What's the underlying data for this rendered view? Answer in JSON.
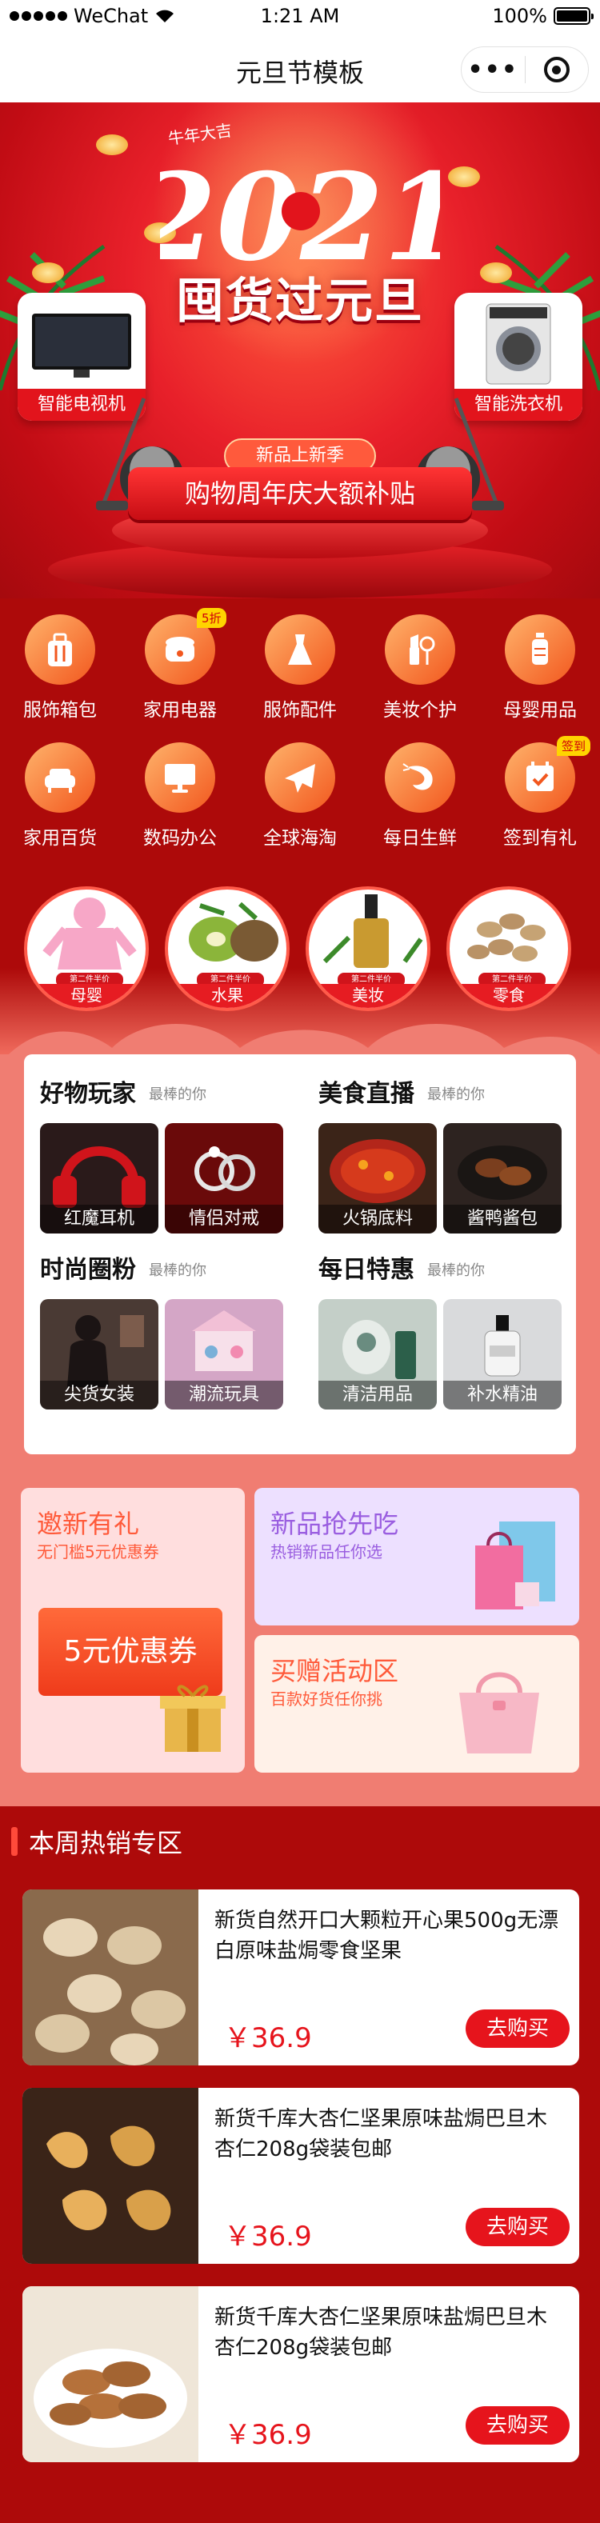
{
  "status": {
    "carrier": "WeChat",
    "time": "1:21 AM",
    "battery": "100%"
  },
  "nav": {
    "title": "元旦节模板"
  },
  "banner": {
    "ox_text": "牛年大吉",
    "year": "2021",
    "headline": "囤货过元旦",
    "pill": "新品上新季",
    "sub": "购物周年庆大额补贴",
    "left_card": "智能电视机",
    "right_card": "智能洗衣机"
  },
  "categories": [
    {
      "label": "服饰箱包",
      "icon": "luggage-icon"
    },
    {
      "label": "家用电器",
      "icon": "rice-cooker-icon",
      "badge": "5折"
    },
    {
      "label": "服饰配件",
      "icon": "dress-icon"
    },
    {
      "label": "美妆个护",
      "icon": "lipstick-icon"
    },
    {
      "label": "母婴用品",
      "icon": "baby-bottle-icon"
    },
    {
      "label": "家用百货",
      "icon": "sofa-icon"
    },
    {
      "label": "数码办公",
      "icon": "monitor-icon"
    },
    {
      "label": "全球海淘",
      "icon": "airplane-icon"
    },
    {
      "label": "每日生鲜",
      "icon": "shrimp-icon"
    },
    {
      "label": "签到有礼",
      "icon": "calendar-check-icon",
      "badge": "签到"
    }
  ],
  "circles": [
    {
      "tag": "第二件半价",
      "name": "母婴"
    },
    {
      "tag": "第二件半价",
      "name": "水果"
    },
    {
      "tag": "第二件半价",
      "name": "美妆"
    },
    {
      "tag": "第二件半价",
      "name": "零食"
    }
  ],
  "blocks": [
    {
      "title": "好物玩家",
      "sub": "最棒的你",
      "items": [
        "红魔耳机",
        "情侣对戒"
      ]
    },
    {
      "title": "美食直播",
      "sub": "最棒的你",
      "items": [
        "火锅底料",
        "酱鸭酱包"
      ]
    },
    {
      "title": "时尚圈粉",
      "sub": "最棒的你",
      "items": [
        "尖货女装",
        "潮流玩具"
      ]
    },
    {
      "title": "每日特惠",
      "sub": "最棒的你",
      "items": [
        "清洁用品",
        "补水精油"
      ]
    }
  ],
  "promos": {
    "invite": {
      "title": "邀新有礼",
      "desc": "无门槛5元优惠券",
      "coupon": "5元优惠券"
    },
    "newitem": {
      "title": "新品抢先吃",
      "desc": "热销新品任你选"
    },
    "activity": {
      "title": "买赠活动区",
      "desc": "百款好货任你挑"
    }
  },
  "hot": {
    "title": "本周热销专区",
    "products": [
      {
        "name": "新货自然开口大颗粒开心果500g无漂白原味盐焗零食坚果",
        "price": "￥36.9",
        "button": "去购买"
      },
      {
        "name": "新货千库大杏仁坚果原味盐焗巴旦木杏仁208g袋装包邮",
        "price": "￥36.9",
        "button": "去购买"
      },
      {
        "name": "新货千库大杏仁坚果原味盐焗巴旦木杏仁208g袋装包邮",
        "price": "￥36.9",
        "button": "去购买"
      }
    ]
  },
  "colors": {
    "brand_red": "#e6141c",
    "page_bg": "#ad0a0a",
    "salmon": "#f07d72"
  }
}
